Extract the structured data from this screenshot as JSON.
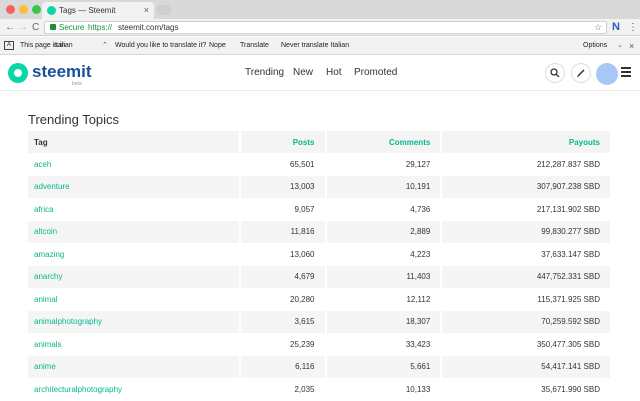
{
  "browser": {
    "tab_title": "Tags — Steemit",
    "tab_close": "×",
    "nav_back": "←",
    "nav_forward": "→",
    "nav_reload": "C",
    "secure_label": "Secure",
    "url_scheme": "https://",
    "url_host_path": "steemit.com/tags",
    "bookmark_star": "☆",
    "extension_label": "N",
    "menu_dots": "⋮"
  },
  "translate_bar": {
    "icon": "A",
    "prompt": "This page is in",
    "language": "Italian",
    "question": "Would you like to translate it?",
    "nope": "Nope",
    "translate": "Translate",
    "never": "Never translate Italian",
    "options": "Options",
    "close": "×"
  },
  "site": {
    "brand": "steemit",
    "beta": "beta",
    "nav": [
      "Trending",
      "New",
      "Hot",
      "Promoted"
    ],
    "search_icon": "search-icon",
    "edit_icon": "pencil-icon"
  },
  "page": {
    "title": "Trending Topics",
    "columns": [
      "Tag",
      "Posts",
      "Comments",
      "Payouts"
    ],
    "rows": [
      {
        "tag": "aceh",
        "posts": "65,501",
        "comments": "29,127",
        "payouts": "212,287.837 SBD"
      },
      {
        "tag": "adventure",
        "posts": "13,003",
        "comments": "10,191",
        "payouts": "307,907.238 SBD"
      },
      {
        "tag": "africa",
        "posts": "9,057",
        "comments": "4,736",
        "payouts": "217,131.902 SBD"
      },
      {
        "tag": "altcoin",
        "posts": "11,816",
        "comments": "2,889",
        "payouts": "99,830.277 SBD"
      },
      {
        "tag": "amazing",
        "posts": "13,060",
        "comments": "4,223",
        "payouts": "37,633.147 SBD"
      },
      {
        "tag": "anarchy",
        "posts": "4,679",
        "comments": "11,403",
        "payouts": "447,752.331 SBD"
      },
      {
        "tag": "animal",
        "posts": "20,280",
        "comments": "12,112",
        "payouts": "115,371.925 SBD"
      },
      {
        "tag": "animalphotography",
        "posts": "3,615",
        "comments": "18,307",
        "payouts": "70,259.592 SBD"
      },
      {
        "tag": "animals",
        "posts": "25,239",
        "comments": "33,423",
        "payouts": "350,477.305 SBD"
      },
      {
        "tag": "anime",
        "posts": "6,116",
        "comments": "5,661",
        "payouts": "54,417.141 SBD"
      },
      {
        "tag": "architecturalphotography",
        "posts": "2,035",
        "comments": "10,133",
        "payouts": "35,671.990 SBD"
      }
    ]
  }
}
